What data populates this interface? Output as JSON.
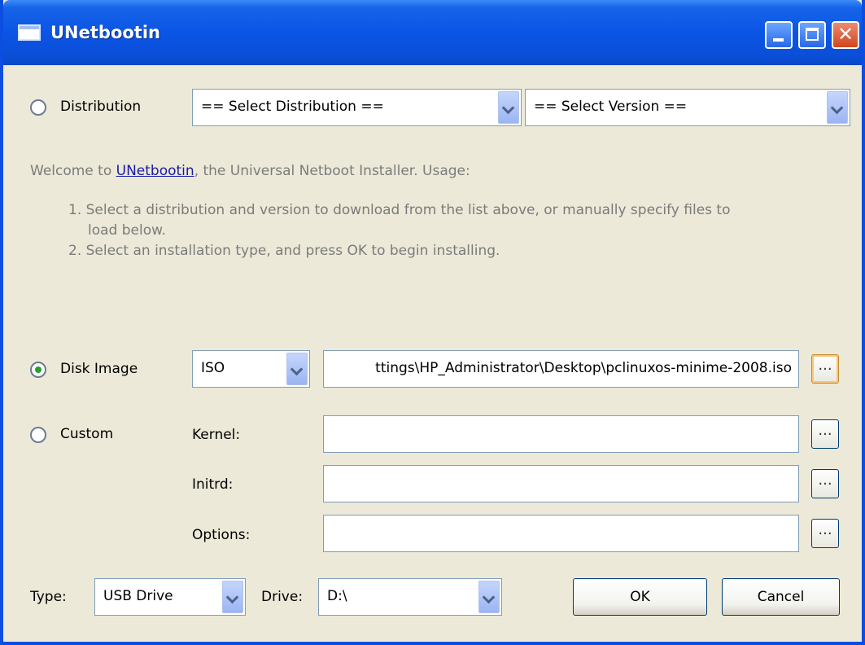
{
  "window": {
    "title": "UNetbootin"
  },
  "distribution": {
    "label": "Distribution",
    "distro_select": "== Select Distribution ==",
    "version_select": "== Select Version =="
  },
  "welcome": {
    "prefix": "Welcome to ",
    "link": "UNetbootin",
    "suffix": ", the Universal Netboot Installer. Usage:",
    "step1_line1": "1. Select a distribution and version to download from the list above, or manually specify files to",
    "step1_line2": "load below.",
    "step2": "2. Select an installation type, and press OK to begin installing."
  },
  "disk_image": {
    "label": "Disk Image",
    "type_select": "ISO",
    "path_value": "ttings\\HP_Administrator\\Desktop\\pclinuxos-minime-2008.iso",
    "browse_label": "..."
  },
  "custom": {
    "label": "Custom",
    "kernel_label": "Kernel:",
    "kernel_value": "",
    "initrd_label": "Initrd:",
    "initrd_value": "",
    "options_label": "Options:",
    "options_value": "",
    "browse_label": "..."
  },
  "bottom": {
    "type_label": "Type:",
    "type_select": "USB Drive",
    "drive_label": "Drive:",
    "drive_select": "D:\\",
    "ok_label": "OK",
    "cancel_label": "Cancel"
  }
}
